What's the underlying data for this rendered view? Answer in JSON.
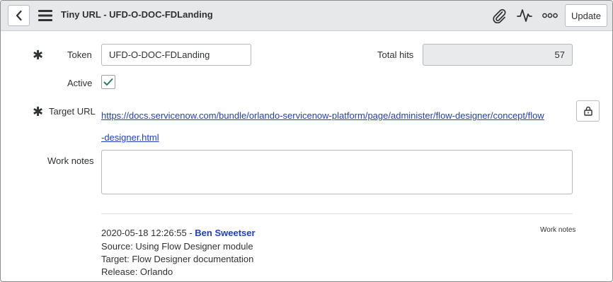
{
  "header": {
    "title": "Tiny URL - UFD-O-DOC-FDLanding",
    "update_label": "Update"
  },
  "form": {
    "token_label": "Token",
    "token_value": "UFD-O-DOC-FDLanding",
    "total_hits_label": "Total hits",
    "total_hits_value": "57",
    "active_label": "Active",
    "active_checked": true,
    "target_url_label": "Target URL",
    "target_url": "https://docs.servicenow.com/bundle/orlando-servicenow-platform/page/administer/flow-designer/concept/flow-designer.html",
    "work_notes_label": "Work notes",
    "work_notes_value": ""
  },
  "activity": {
    "timestamp": "2020-05-18 12:26:55",
    "separator": " - ",
    "author": "Ben Sweetser",
    "type": "Work notes",
    "lines": [
      "Source: Using Flow Designer module",
      "Target: Flow Designer documentation",
      "Release: Orlando"
    ]
  },
  "colors": {
    "header_bg": "#e6e8ea",
    "link": "#1f3fbf",
    "check": "#2b7a5e"
  },
  "icons": [
    "back-icon",
    "hamburger-menu-icon",
    "paperclip-icon",
    "activity-pulse-icon",
    "more-options-icon",
    "unlock-icon",
    "checkmark-icon",
    "required-asterisk-icon"
  ]
}
